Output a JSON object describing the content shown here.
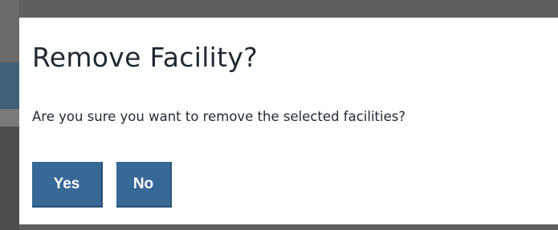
{
  "dialog": {
    "title": "Remove Facility?",
    "message": "Are you sure you want to remove the selected facilities?",
    "buttons": {
      "yes": "Yes",
      "no": "No"
    }
  },
  "colors": {
    "button_background": "#376996",
    "button_text": "#ffffff",
    "overlay": "#5f5f5f",
    "dialog_background": "#ffffff",
    "text": "#1f2a33"
  }
}
